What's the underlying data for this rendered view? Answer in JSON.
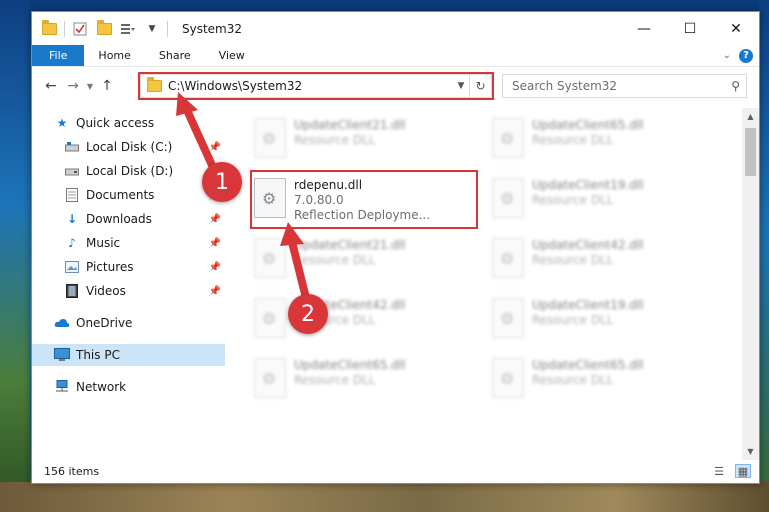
{
  "window": {
    "title": "System32",
    "close_glyph": "✕",
    "maximize_glyph": "☐",
    "minimize_glyph": "—"
  },
  "ribbon": {
    "tabs": [
      {
        "label": "File"
      },
      {
        "label": "Home"
      },
      {
        "label": "Share"
      },
      {
        "label": "View"
      }
    ],
    "help_glyph": "?"
  },
  "navigation": {
    "address_path": "C:\\Windows\\System32",
    "search_placeholder": "Search System32"
  },
  "sidebar": {
    "items": [
      {
        "label": "Quick access",
        "icon": "star-icon",
        "pinned": false
      },
      {
        "label": "Local Disk (C:)",
        "icon": "drive-icon",
        "pinned": true
      },
      {
        "label": "Local Disk (D:)",
        "icon": "drive-icon",
        "pinned": true
      },
      {
        "label": "Documents",
        "icon": "documents-icon",
        "pinned": true
      },
      {
        "label": "Downloads",
        "icon": "downloads-icon",
        "pinned": true
      },
      {
        "label": "Music",
        "icon": "music-icon",
        "pinned": true
      },
      {
        "label": "Pictures",
        "icon": "pictures-icon",
        "pinned": true
      },
      {
        "label": "Videos",
        "icon": "videos-icon",
        "pinned": true
      },
      {
        "label": "OneDrive",
        "icon": "onedrive-icon",
        "pinned": false
      },
      {
        "label": "This PC",
        "icon": "this-pc-icon",
        "pinned": false,
        "selected": true
      },
      {
        "label": "Network",
        "icon": "network-icon",
        "pinned": false
      }
    ]
  },
  "files": {
    "featured": {
      "name": "rdepenu.dll",
      "version": "7.0.80.0",
      "description": "Reflection Deployme..."
    },
    "blurred": [
      {
        "name": "UpdateClient21.dll",
        "type": "Resource DLL"
      },
      {
        "name": "UpdateClient65.dll",
        "type": "Resource DLL"
      },
      {
        "name": "UpdateClient19.dll",
        "type": "Resource DLL"
      },
      {
        "name": "UpdateClient21.dll",
        "type": "Resource DLL"
      },
      {
        "name": "UpdateClient42.dll",
        "type": "Resource DLL"
      },
      {
        "name": "UpdateClient42.dll",
        "type": "Resource DLL"
      },
      {
        "name": "UpdateClient19.dll",
        "type": "Resource DLL"
      },
      {
        "name": "UpdateClient65.dll",
        "type": "Resource DLL"
      },
      {
        "name": "UpdateClient65.dll",
        "type": "Resource DLL"
      }
    ]
  },
  "status": {
    "item_count": "156 items"
  },
  "annotations": {
    "step1": "1",
    "step2": "2",
    "color": "#d9363a"
  },
  "colors": {
    "accent": "#1979ca",
    "selection": "#cce4f7",
    "highlight": "#d9363a"
  }
}
